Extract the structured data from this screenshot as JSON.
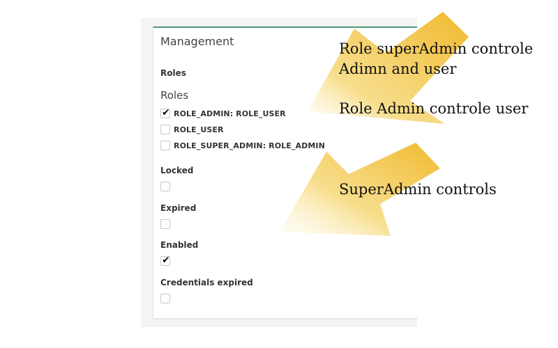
{
  "panel": {
    "title": "Management",
    "roles_field_label": "Roles",
    "roles_subheading": "Roles",
    "roles": [
      {
        "label": "ROLE_ADMIN: ROLE_USER",
        "checked": true
      },
      {
        "label": "ROLE_USER",
        "checked": false
      },
      {
        "label": "ROLE_SUPER_ADMIN: ROLE_ADMIN",
        "checked": false
      }
    ],
    "fields": [
      {
        "label": "Locked",
        "checked": false
      },
      {
        "label": "Expired",
        "checked": false
      },
      {
        "label": "Enabled",
        "checked": true
      },
      {
        "label": "Credentials expired",
        "checked": false
      }
    ],
    "accent_color": "#4a9a78"
  },
  "annotations": {
    "line1": "Role superAdmin controle",
    "line2": "Adimn and user",
    "line3": "Role Admin controle user",
    "line4": "SuperAdmin controls"
  },
  "arrow_color": "#f2c54b"
}
